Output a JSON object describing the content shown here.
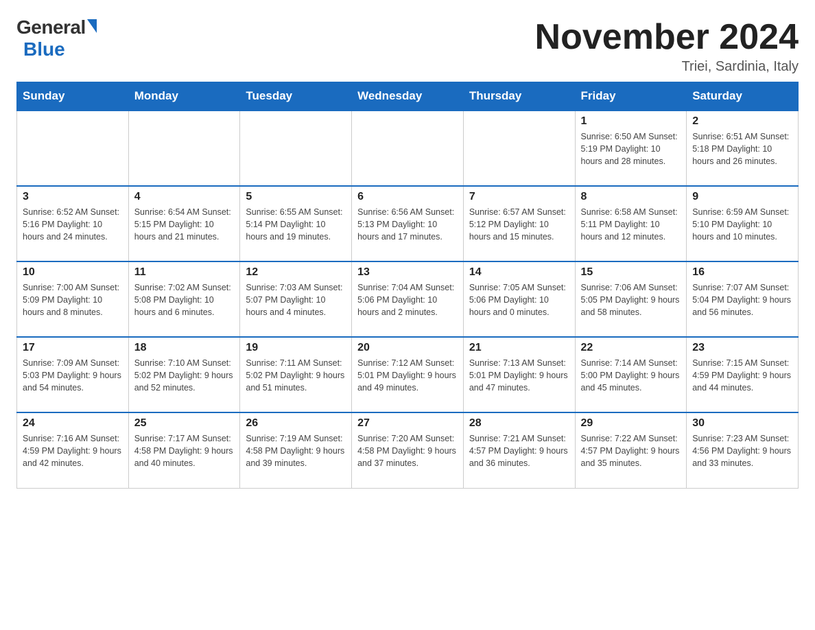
{
  "header": {
    "logo_general": "General",
    "logo_blue": "Blue",
    "month_title": "November 2024",
    "location": "Triei, Sardinia, Italy"
  },
  "weekdays": [
    "Sunday",
    "Monday",
    "Tuesday",
    "Wednesday",
    "Thursday",
    "Friday",
    "Saturday"
  ],
  "weeks": [
    [
      {
        "day": "",
        "info": ""
      },
      {
        "day": "",
        "info": ""
      },
      {
        "day": "",
        "info": ""
      },
      {
        "day": "",
        "info": ""
      },
      {
        "day": "",
        "info": ""
      },
      {
        "day": "1",
        "info": "Sunrise: 6:50 AM\nSunset: 5:19 PM\nDaylight: 10 hours and 28 minutes."
      },
      {
        "day": "2",
        "info": "Sunrise: 6:51 AM\nSunset: 5:18 PM\nDaylight: 10 hours and 26 minutes."
      }
    ],
    [
      {
        "day": "3",
        "info": "Sunrise: 6:52 AM\nSunset: 5:16 PM\nDaylight: 10 hours and 24 minutes."
      },
      {
        "day": "4",
        "info": "Sunrise: 6:54 AM\nSunset: 5:15 PM\nDaylight: 10 hours and 21 minutes."
      },
      {
        "day": "5",
        "info": "Sunrise: 6:55 AM\nSunset: 5:14 PM\nDaylight: 10 hours and 19 minutes."
      },
      {
        "day": "6",
        "info": "Sunrise: 6:56 AM\nSunset: 5:13 PM\nDaylight: 10 hours and 17 minutes."
      },
      {
        "day": "7",
        "info": "Sunrise: 6:57 AM\nSunset: 5:12 PM\nDaylight: 10 hours and 15 minutes."
      },
      {
        "day": "8",
        "info": "Sunrise: 6:58 AM\nSunset: 5:11 PM\nDaylight: 10 hours and 12 minutes."
      },
      {
        "day": "9",
        "info": "Sunrise: 6:59 AM\nSunset: 5:10 PM\nDaylight: 10 hours and 10 minutes."
      }
    ],
    [
      {
        "day": "10",
        "info": "Sunrise: 7:00 AM\nSunset: 5:09 PM\nDaylight: 10 hours and 8 minutes."
      },
      {
        "day": "11",
        "info": "Sunrise: 7:02 AM\nSunset: 5:08 PM\nDaylight: 10 hours and 6 minutes."
      },
      {
        "day": "12",
        "info": "Sunrise: 7:03 AM\nSunset: 5:07 PM\nDaylight: 10 hours and 4 minutes."
      },
      {
        "day": "13",
        "info": "Sunrise: 7:04 AM\nSunset: 5:06 PM\nDaylight: 10 hours and 2 minutes."
      },
      {
        "day": "14",
        "info": "Sunrise: 7:05 AM\nSunset: 5:06 PM\nDaylight: 10 hours and 0 minutes."
      },
      {
        "day": "15",
        "info": "Sunrise: 7:06 AM\nSunset: 5:05 PM\nDaylight: 9 hours and 58 minutes."
      },
      {
        "day": "16",
        "info": "Sunrise: 7:07 AM\nSunset: 5:04 PM\nDaylight: 9 hours and 56 minutes."
      }
    ],
    [
      {
        "day": "17",
        "info": "Sunrise: 7:09 AM\nSunset: 5:03 PM\nDaylight: 9 hours and 54 minutes."
      },
      {
        "day": "18",
        "info": "Sunrise: 7:10 AM\nSunset: 5:02 PM\nDaylight: 9 hours and 52 minutes."
      },
      {
        "day": "19",
        "info": "Sunrise: 7:11 AM\nSunset: 5:02 PM\nDaylight: 9 hours and 51 minutes."
      },
      {
        "day": "20",
        "info": "Sunrise: 7:12 AM\nSunset: 5:01 PM\nDaylight: 9 hours and 49 minutes."
      },
      {
        "day": "21",
        "info": "Sunrise: 7:13 AM\nSunset: 5:01 PM\nDaylight: 9 hours and 47 minutes."
      },
      {
        "day": "22",
        "info": "Sunrise: 7:14 AM\nSunset: 5:00 PM\nDaylight: 9 hours and 45 minutes."
      },
      {
        "day": "23",
        "info": "Sunrise: 7:15 AM\nSunset: 4:59 PM\nDaylight: 9 hours and 44 minutes."
      }
    ],
    [
      {
        "day": "24",
        "info": "Sunrise: 7:16 AM\nSunset: 4:59 PM\nDaylight: 9 hours and 42 minutes."
      },
      {
        "day": "25",
        "info": "Sunrise: 7:17 AM\nSunset: 4:58 PM\nDaylight: 9 hours and 40 minutes."
      },
      {
        "day": "26",
        "info": "Sunrise: 7:19 AM\nSunset: 4:58 PM\nDaylight: 9 hours and 39 minutes."
      },
      {
        "day": "27",
        "info": "Sunrise: 7:20 AM\nSunset: 4:58 PM\nDaylight: 9 hours and 37 minutes."
      },
      {
        "day": "28",
        "info": "Sunrise: 7:21 AM\nSunset: 4:57 PM\nDaylight: 9 hours and 36 minutes."
      },
      {
        "day": "29",
        "info": "Sunrise: 7:22 AM\nSunset: 4:57 PM\nDaylight: 9 hours and 35 minutes."
      },
      {
        "day": "30",
        "info": "Sunrise: 7:23 AM\nSunset: 4:56 PM\nDaylight: 9 hours and 33 minutes."
      }
    ]
  ]
}
